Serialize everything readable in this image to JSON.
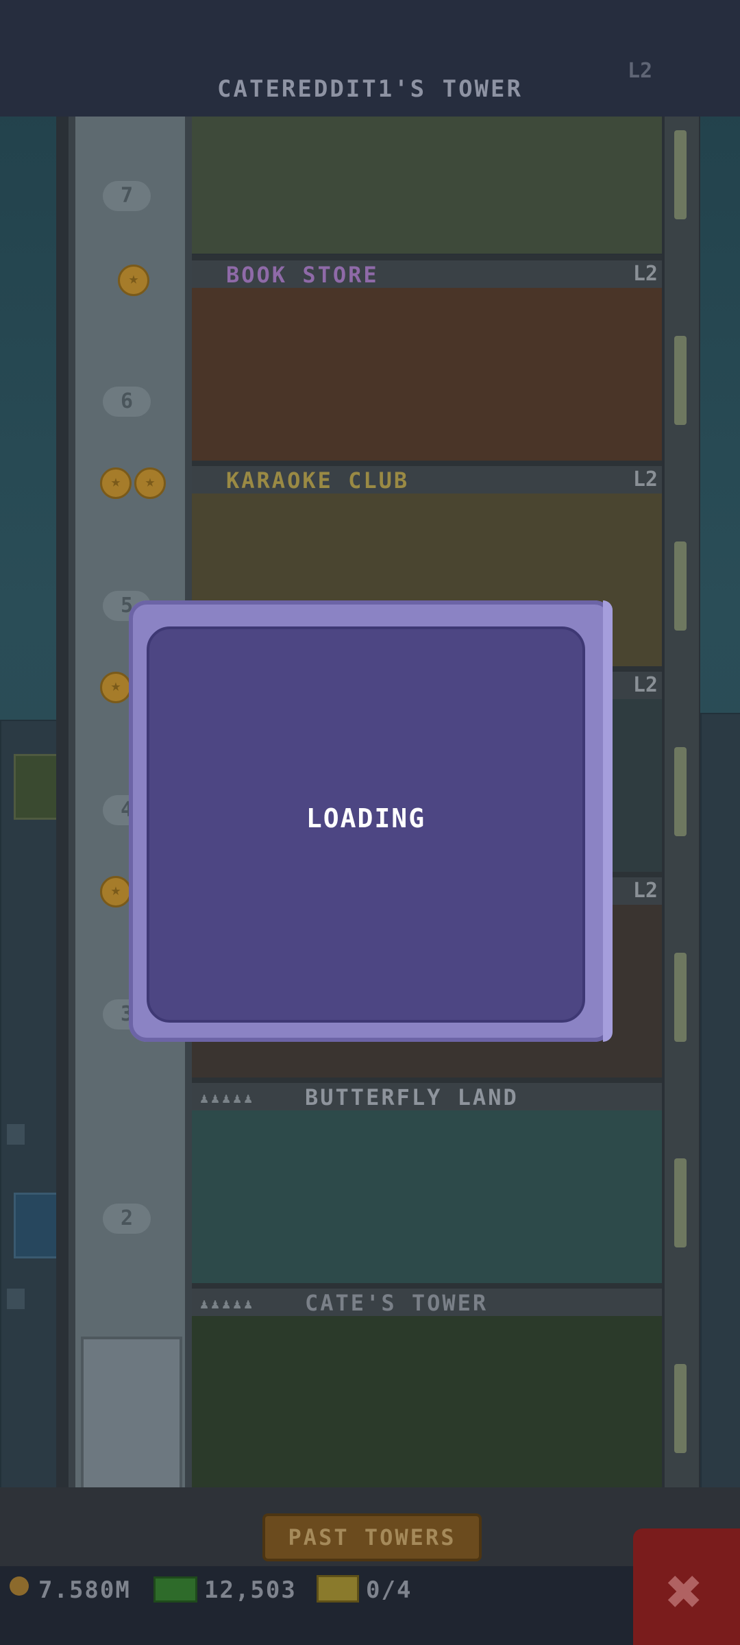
{
  "header": {
    "tower_title": "CATEREDDIT1'S TOWER",
    "tower_level": "L2"
  },
  "floors": [
    {
      "name": "BOOK STORE",
      "level": "L2",
      "color": "#8f6aa8"
    },
    {
      "name": "KARAOKE CLUB",
      "level": "L2",
      "color": "#9a8a44"
    },
    {
      "name": "",
      "level": "L2",
      "color": "#8a9096"
    },
    {
      "name": "",
      "level": "L2",
      "color": "#8a9096"
    },
    {
      "name": "BUTTERFLY LAND",
      "level": "",
      "color": "#8e949c"
    },
    {
      "name": "CATE'S TOWER",
      "level": "",
      "color": "#7a8088"
    }
  ],
  "floor_numbers": [
    "7",
    "6",
    "5",
    "4",
    "3",
    "2"
  ],
  "modal": {
    "message": "LOADING"
  },
  "bottom": {
    "past_towers_label": "PAST TOWERS",
    "coins": "7.580M",
    "bux": "12,503",
    "tickets": "0/4"
  },
  "colors": {
    "modal_frame": "#8b83c4",
    "modal_fill": "#4d4683",
    "close_button": "#7a1c1c",
    "past_towers_button": "#6b4b1e"
  },
  "icons": [
    "coin-icon",
    "bux-icon",
    "ticket-icon",
    "close-icon",
    "people-icon"
  ]
}
